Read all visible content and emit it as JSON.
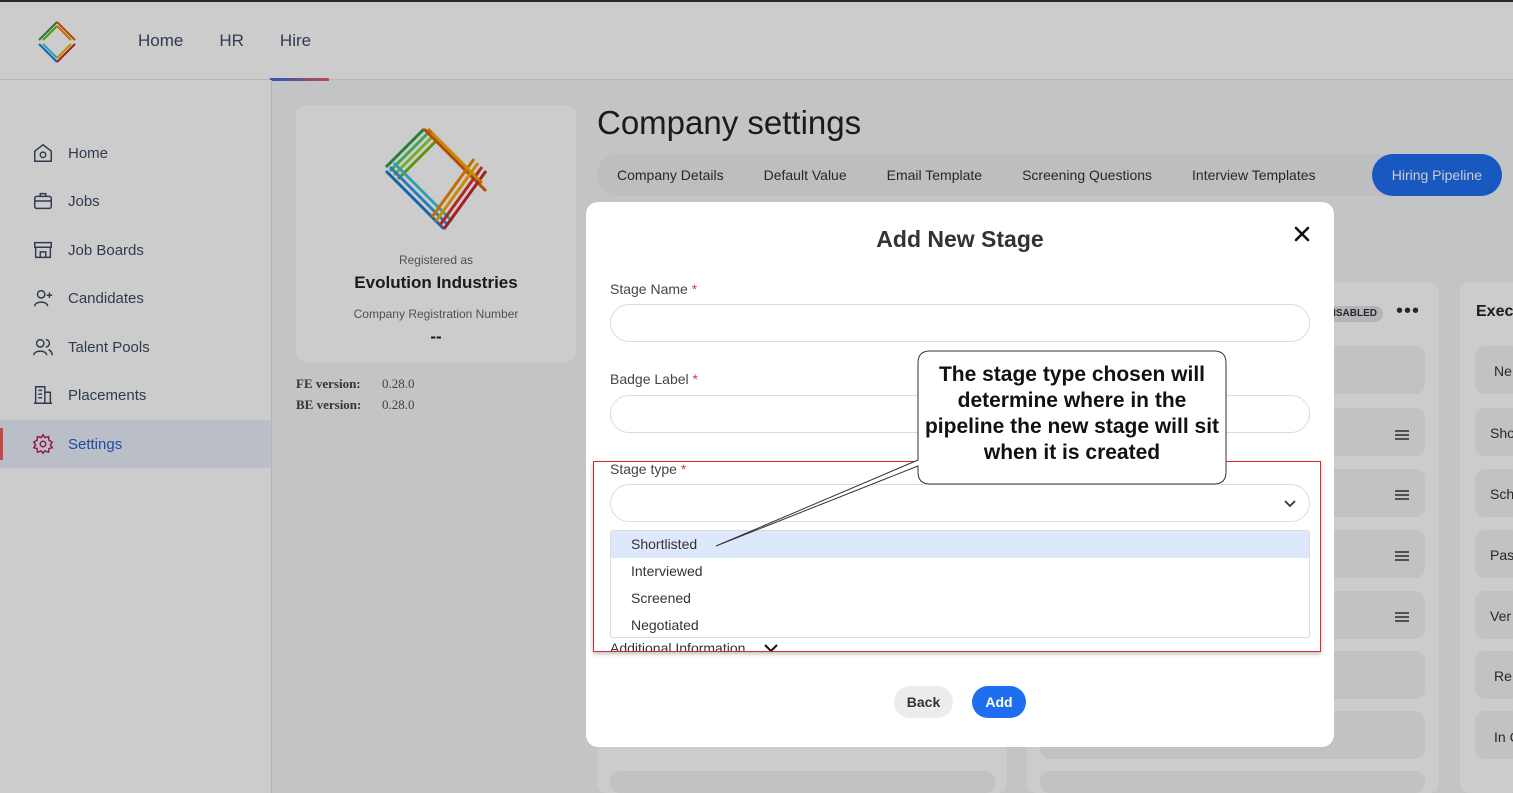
{
  "topnav": {
    "items": [
      {
        "label": "Home"
      },
      {
        "label": "HR"
      },
      {
        "label": "Hire"
      }
    ]
  },
  "sidebar": {
    "items": [
      {
        "label": "Home",
        "icon": "home-icon"
      },
      {
        "label": "Jobs",
        "icon": "briefcase-icon"
      },
      {
        "label": "Job Boards",
        "icon": "storefront-icon"
      },
      {
        "label": "Candidates",
        "icon": "add-user-icon"
      },
      {
        "label": "Talent Pools",
        "icon": "users-icon"
      },
      {
        "label": "Placements",
        "icon": "building-icon"
      },
      {
        "label": "Settings",
        "icon": "gear-icon"
      }
    ]
  },
  "company": {
    "registered_as_label": "Registered as",
    "name": "Evolution Industries",
    "reg_number_label": "Company Registration Number",
    "reg_number": "--"
  },
  "versions": {
    "fe_label": "FE version:",
    "fe_value": "0.28.0",
    "be_label": "BE version:",
    "be_value": "0.28.0"
  },
  "page": {
    "title": "Company settings"
  },
  "tabs": [
    {
      "label": "Company Details"
    },
    {
      "label": "Default Value"
    },
    {
      "label": "Email Template"
    },
    {
      "label": "Screening Questions"
    },
    {
      "label": "Interview Templates"
    },
    {
      "label": "Hiring Pipeline"
    }
  ],
  "background": {
    "disabled_badge": "DISABLED",
    "exec_title": "Exec",
    "exec_items": [
      "Ne",
      "Sho",
      "Sch",
      "Pas",
      "Ver",
      "Re",
      "In C"
    ]
  },
  "modal": {
    "title": "Add New Stage",
    "stage_name_label": "Stage Name",
    "badge_label_label": "Badge Label",
    "stage_type_label": "Stage type",
    "required_mark": "*",
    "stage_type_options": [
      "Shortlisted",
      "Interviewed",
      "Screened",
      "Negotiated"
    ],
    "additional_info": "Additional Information",
    "back_label": "Back",
    "add_label": "Add"
  },
  "callout": {
    "text": "The stage type chosen will determine where in the pipeline the new stage will sit when it is created"
  },
  "colors": {
    "primary": "#1e6ef0",
    "annotation": "#d92b2b",
    "highlight_option": "#dde8fb"
  }
}
